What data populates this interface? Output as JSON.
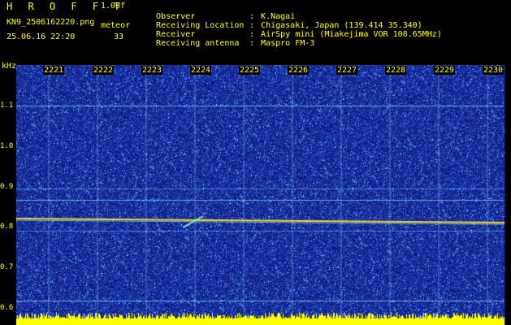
{
  "header": {
    "title": "H R O F F T",
    "version": "1.00f",
    "filename": "KN9_2506162220.png",
    "meteor_label": "meteor",
    "meteor_count": "33",
    "datetime": "25.06.16 22:20",
    "info": [
      {
        "key": "Observer",
        "value": "K.Nagai"
      },
      {
        "key": "Receiving Location",
        "value": "Chigasaki, Japan (139.414 35.340)"
      },
      {
        "key": "Receiver",
        "value": "AirSpy mini (Miakejima VOR 108.65MHz)"
      },
      {
        "key": "Receiving antenna",
        "value": "Maspro FM-3"
      }
    ]
  },
  "axis": {
    "y_unit": "kHz",
    "y_ticks": [
      "1.1",
      "1.0",
      "0.9",
      "0.8",
      "0.7",
      "0.6"
    ],
    "time_ticks": [
      "2221",
      "2222",
      "2223",
      "2224",
      "2225",
      "2226",
      "2227",
      "2228",
      "2229",
      "2230"
    ]
  },
  "colors": {
    "background": "#000000",
    "text": "#ffff00",
    "spectrum_bg": "#1a2fa8",
    "signal": "#ffcc33"
  }
}
